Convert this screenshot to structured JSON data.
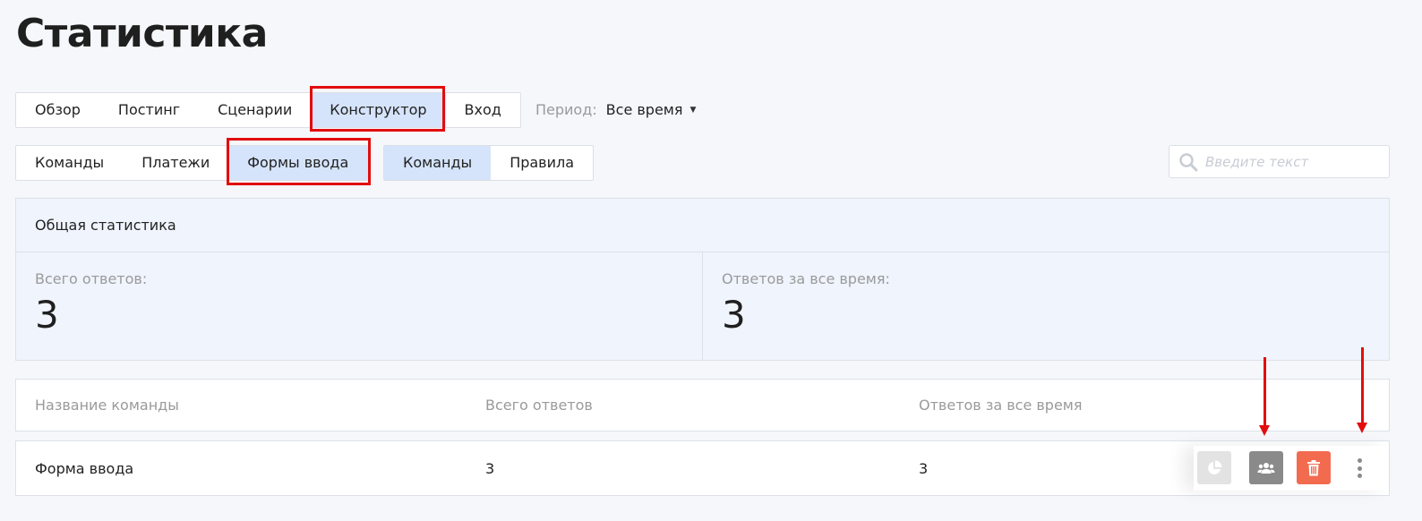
{
  "page": {
    "title": "Статистика"
  },
  "main_tabs": [
    {
      "label": "Обзор",
      "active": false
    },
    {
      "label": "Постинг",
      "active": false
    },
    {
      "label": "Сценарии",
      "active": false
    },
    {
      "label": "Конструктор",
      "active": true
    },
    {
      "label": "Вход",
      "active": false
    }
  ],
  "period": {
    "label": "Период:",
    "value": "Все время"
  },
  "sub_tabs": [
    {
      "label": "Команды",
      "active": false
    },
    {
      "label": "Платежи",
      "active": false
    },
    {
      "label": "Формы ввода",
      "active": true
    }
  ],
  "sub_tabs2": [
    {
      "label": "Команды",
      "active": true
    },
    {
      "label": "Правила",
      "active": false
    }
  ],
  "search": {
    "placeholder": "Введите текст",
    "icon": "search-icon"
  },
  "stats": {
    "header": "Общая статистика",
    "cells": [
      {
        "label": "Всего ответов:",
        "value": "3"
      },
      {
        "label": "Ответов за все время:",
        "value": "3"
      }
    ]
  },
  "table": {
    "columns": [
      "Название команды",
      "Всего ответов",
      "Ответов за все время"
    ],
    "rows": [
      {
        "name": "Форма ввода",
        "total": "3",
        "all_time": "3"
      }
    ],
    "row_actions": [
      "pie-chart-icon",
      "users-icon",
      "trash-icon",
      "more-vertical-icon"
    ]
  },
  "colors": {
    "accent_active_tab": "#d5e4fb",
    "highlight": "#e20d0d",
    "delete_button": "#f26b4f",
    "users_button": "#8a8a8a",
    "stats_button": "#e3e3e3"
  }
}
